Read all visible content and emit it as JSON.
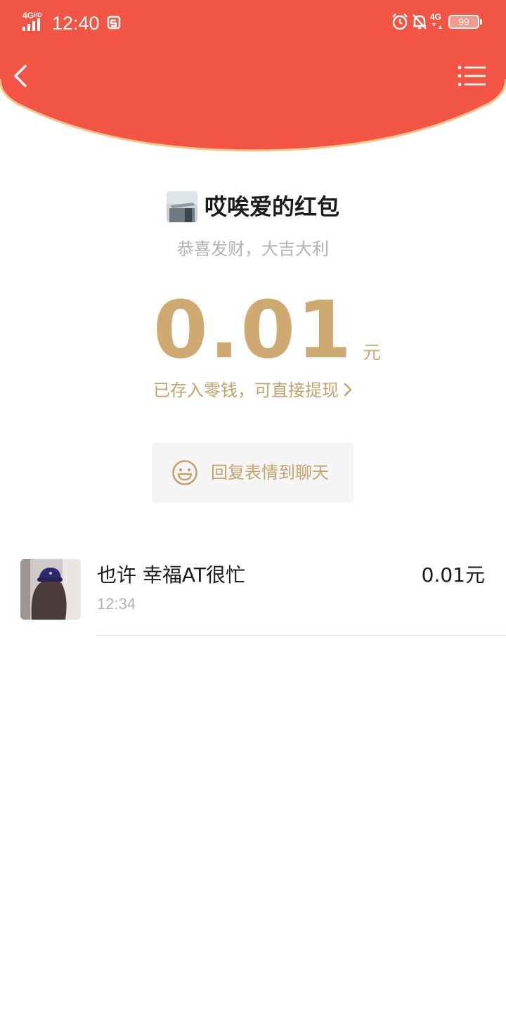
{
  "colors": {
    "header_red": "#f25543",
    "header_edge": "#f4c58a",
    "gold": "#cfa972",
    "gold_text": "#c4a26b",
    "muted_text": "#b2b2b2",
    "dark_text": "#1a1a1a",
    "button_bg": "#f5f5f5"
  },
  "status_bar": {
    "network": "4G",
    "network_hd": "HD",
    "time": "12:40",
    "icons": [
      "alarm-icon",
      "notification-muted-icon",
      "4g-data-icon"
    ],
    "data_label": "4G",
    "battery": "99"
  },
  "nav": {
    "back_icon": "chevron-left-icon",
    "menu_icon": "list-menu-icon"
  },
  "sender": {
    "name": "哎唉爱的红包",
    "wish": "恭喜发财，大吉大利"
  },
  "amount": {
    "value": "0.01",
    "unit": "元"
  },
  "saved_link": {
    "text": "已存入零钱，可直接提现"
  },
  "reply_button": {
    "icon": "smile-icon",
    "label": "回复表情到聊天"
  },
  "receivers": [
    {
      "name": "也许 幸福AT很忙",
      "time": "12:34",
      "amount": "0.01元"
    }
  ]
}
